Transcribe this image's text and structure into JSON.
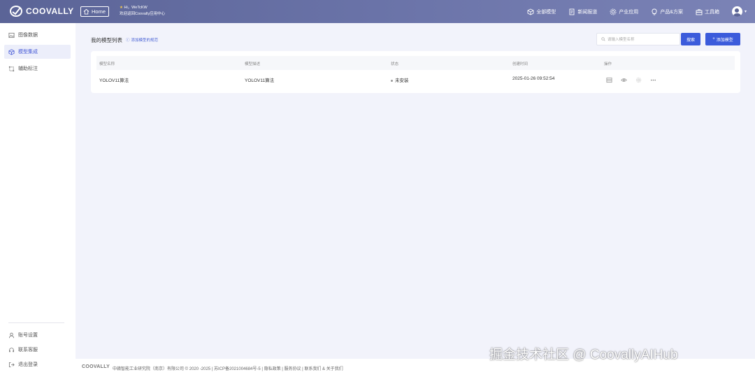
{
  "header": {
    "logo_text": "COOVALLY",
    "home_label": "Home",
    "greeting_line1": "Hi，WeTcKW",
    "greeting_line2": "欢迎返回Coovally应用中心",
    "nav": [
      {
        "label": "全部模型",
        "icon": "cube-icon"
      },
      {
        "label": "新闻报道",
        "icon": "document-icon"
      },
      {
        "label": "产业应用",
        "icon": "gear-icon"
      },
      {
        "label": "产品&方案",
        "icon": "lightbulb-icon"
      },
      {
        "label": "工具箱",
        "icon": "toolbox-icon"
      }
    ]
  },
  "sidebar": {
    "items": [
      {
        "label": "图像数据",
        "icon": "image-icon",
        "active": false
      },
      {
        "label": "模型集成",
        "icon": "cube-icon",
        "active": true
      },
      {
        "label": "辅助标注",
        "icon": "annotate-icon",
        "active": false
      }
    ],
    "bottom_items": [
      {
        "label": "账号设置",
        "icon": "user-icon"
      },
      {
        "label": "联系客服",
        "icon": "headset-icon"
      },
      {
        "label": "退出登录",
        "icon": "logout-icon"
      }
    ]
  },
  "main": {
    "title": "我的模型列表",
    "help_link": "添加模型的规范",
    "search_placeholder": "请输入模型名称",
    "search_button": "搜索",
    "add_button": "添加模型",
    "columns": [
      "模型名称",
      "模型描述",
      "状态",
      "创建时间",
      "操作"
    ],
    "rows": [
      {
        "name": "YOLOV11算法",
        "description": "YOLOV11算法",
        "status": "未安装",
        "created": "2025-01-26 09:52:54"
      }
    ]
  },
  "footer": {
    "logo_text": "COOVALLY",
    "text": "中赣智能工业研究院（南京）有限公司 © 2020 -2025 | 苏ICP备2021004684号-5 | 隐私政策 | 服务协议 | 联系我们 & 关于我们"
  },
  "watermark": "掘金技术社区 @ CoovallyAIHub",
  "colors": {
    "header": "#5b6497",
    "primary": "#3b5bdb",
    "active_bg": "#eceefa",
    "page_bg": "#f2f3fb"
  }
}
